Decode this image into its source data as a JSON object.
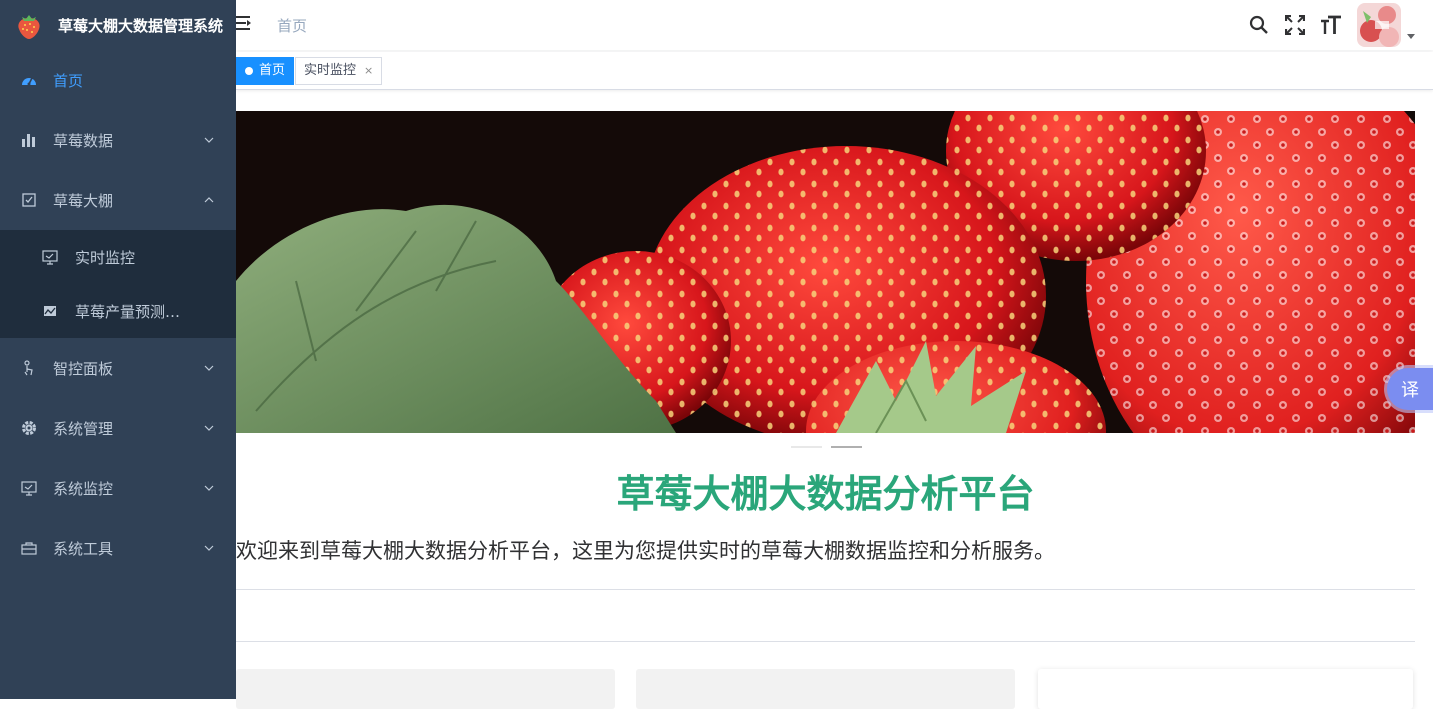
{
  "app": {
    "title": "草莓大棚大数据管理系统"
  },
  "sidebar": {
    "items": [
      {
        "label": "首页",
        "icon": "dashboard-icon",
        "active": true
      },
      {
        "label": "草莓数据",
        "icon": "bar-chart-icon",
        "expanded": false
      },
      {
        "label": "草莓大棚",
        "icon": "checkbox-icon",
        "expanded": true,
        "children": [
          {
            "label": "实时监控",
            "icon": "monitor-icon"
          },
          {
            "label": "草莓产量预测…",
            "icon": "chart-image-icon"
          }
        ]
      },
      {
        "label": "智控面板",
        "icon": "pointer-icon",
        "expanded": false
      },
      {
        "label": "系统管理",
        "icon": "gear-icon",
        "expanded": false
      },
      {
        "label": "系统监控",
        "icon": "monitor-icon",
        "expanded": false
      },
      {
        "label": "系统工具",
        "icon": "toolbox-icon",
        "expanded": false
      }
    ]
  },
  "navbar": {
    "breadcrumb": "首页",
    "icons": [
      "search-icon",
      "fullscreen-icon",
      "font-size-icon"
    ]
  },
  "tags": [
    {
      "label": "首页",
      "active": true
    },
    {
      "label": "实时监控",
      "active": false
    }
  ],
  "main": {
    "title": "草莓大棚大数据分析平台",
    "welcome": "欢迎来到草莓大棚大数据分析平台，这里为您提供实时的草莓大棚数据监控和分析服务。"
  },
  "translate": {
    "label": "译"
  },
  "colors": {
    "sidebar_bg": "#304156",
    "accent": "#409eff",
    "title_green": "#2aa67a"
  }
}
